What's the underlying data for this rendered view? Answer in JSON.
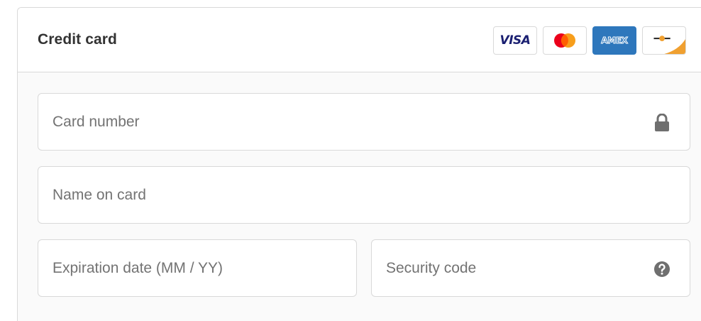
{
  "header": {
    "title": "Credit card"
  },
  "card_logos": [
    {
      "name": "visa",
      "text": "VISA"
    },
    {
      "name": "mastercard",
      "text": ""
    },
    {
      "name": "amex",
      "text": "AMEX"
    },
    {
      "name": "discover",
      "text": ""
    }
  ],
  "fields": {
    "card_number": {
      "placeholder": "Card number",
      "value": "",
      "icon": "lock-icon"
    },
    "name_on_card": {
      "placeholder": "Name on card",
      "value": ""
    },
    "expiration": {
      "placeholder": "Expiration date (MM / YY)",
      "value": ""
    },
    "security_code": {
      "placeholder": "Security code",
      "value": "",
      "icon": "help-icon"
    }
  },
  "colors": {
    "visa_blue": "#1a1f71",
    "mastercard_red": "#eb001b",
    "mastercard_orange": "#f79e1b",
    "amex_blue": "#2e77bc",
    "discover_orange": "#f0a030",
    "border": "#d9d9d9",
    "placeholder": "#737373",
    "icon_gray": "#6f6f6f"
  }
}
